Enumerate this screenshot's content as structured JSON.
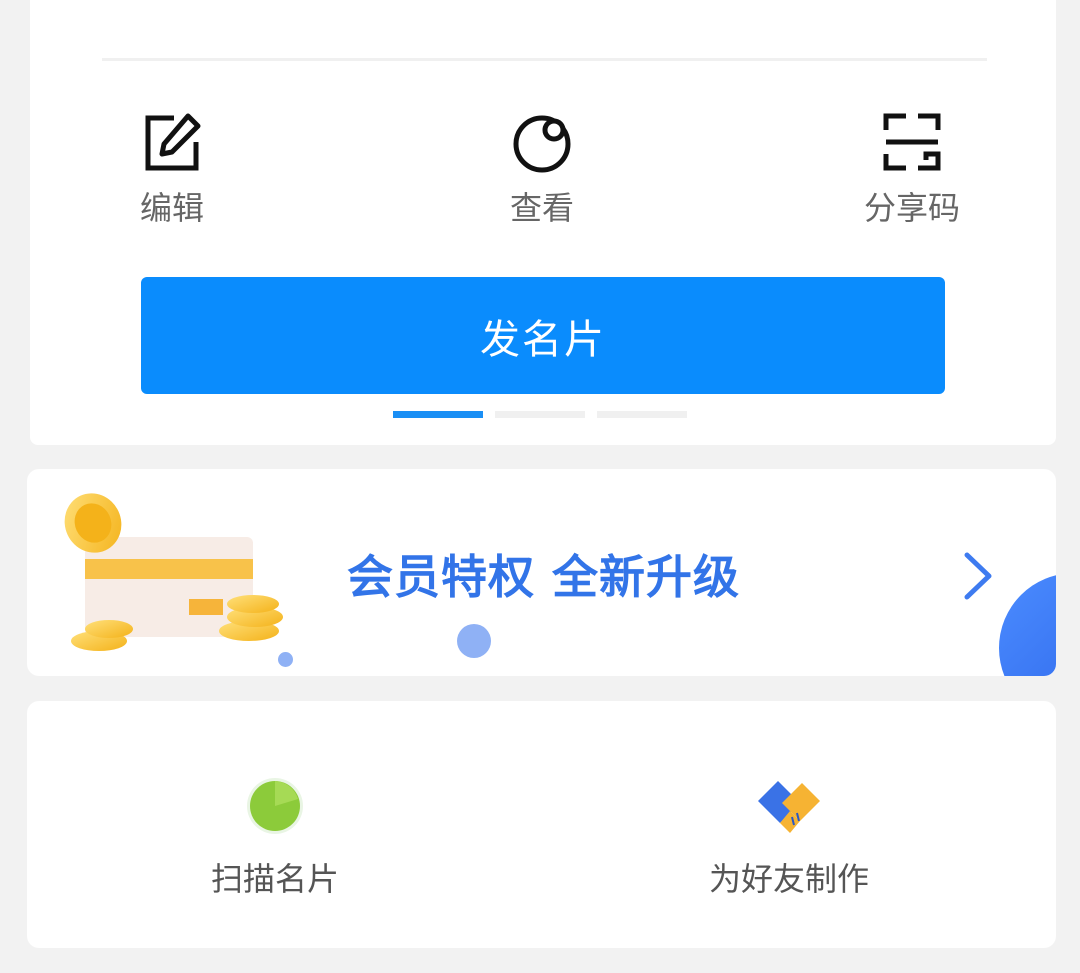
{
  "actions": [
    {
      "label": "编辑",
      "icon": "edit-icon"
    },
    {
      "label": "查看",
      "icon": "view-icon"
    },
    {
      "label": "分享码",
      "icon": "qr-code-icon"
    }
  ],
  "send_button": {
    "label": "发名片"
  },
  "pager": {
    "count": 3,
    "active": 1
  },
  "vip_banner": {
    "text": "会员特权 全新升级",
    "icon": "chevron-right-icon"
  },
  "tools": [
    {
      "label": "扫描名片",
      "icon": "scan-icon"
    },
    {
      "label": "为好友制作",
      "icon": "handshake-icon"
    }
  ],
  "colors": {
    "accent": "#0a8cfd",
    "vip_text": "#3274e8",
    "background": "#f2f2f2"
  }
}
